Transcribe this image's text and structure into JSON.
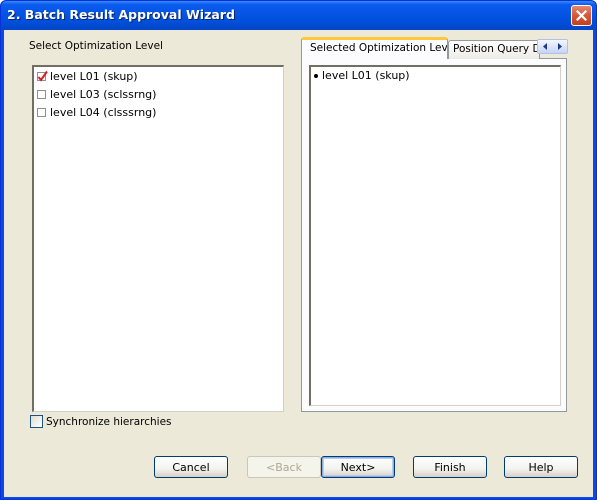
{
  "window": {
    "title": "2. Batch Result Approval Wizard",
    "close_icon": "close-icon"
  },
  "left_panel": {
    "heading": "Select Optimization Level",
    "items": [
      {
        "label": "level L01 (skup)",
        "checked": true
      },
      {
        "label": "level L03 (sclssrng)",
        "checked": false
      },
      {
        "label": "level L04 (clsssrng)",
        "checked": false
      }
    ]
  },
  "right_panel": {
    "tabs": [
      {
        "label": "Selected Optimization Level",
        "active": true
      },
      {
        "label": "Position Query De",
        "active": false
      }
    ],
    "selected_items": [
      "level L01 (skup)"
    ],
    "scroll_icons": [
      "arrow-left-icon",
      "arrow-right-icon"
    ]
  },
  "sync": {
    "label": "Synchronize hierarchies",
    "checked": false
  },
  "buttons": {
    "cancel": "Cancel",
    "back": "<Back",
    "next": "Next>",
    "finish": "Finish",
    "help": "Help"
  },
  "colors": {
    "title_bar": "#0554e3",
    "dialog_bg": "#ece9d8",
    "active_tab_accent": "#ffc83c",
    "check_mark": "#d81e1e"
  }
}
